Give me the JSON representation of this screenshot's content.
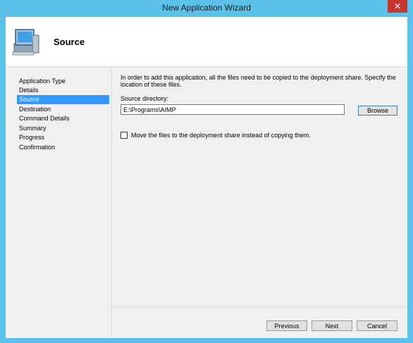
{
  "window": {
    "title": "New Application Wizard",
    "close_glyph": "✕"
  },
  "header": {
    "title": "Source",
    "icon": "computer-icon"
  },
  "nav": {
    "items": [
      {
        "label": "Application Type"
      },
      {
        "label": "Details"
      },
      {
        "label": "Source",
        "active": true
      },
      {
        "label": "Destination"
      },
      {
        "label": "Command Details"
      },
      {
        "label": "Summary"
      },
      {
        "label": "Progress"
      },
      {
        "label": "Confirmation"
      }
    ]
  },
  "source": {
    "description": "In order to add this application, all the files need to be copied to the deployment share.  Specify the location of these files.",
    "directory_label": "Source directory:",
    "directory_value": "E:\\Programs\\AIMP",
    "browse_label": "Browse",
    "move_files_label": "Move the files to the deployment share instead of copying them.",
    "move_files_checked": false
  },
  "buttons": {
    "previous": "Previous",
    "next": "Next",
    "cancel": "Cancel"
  }
}
